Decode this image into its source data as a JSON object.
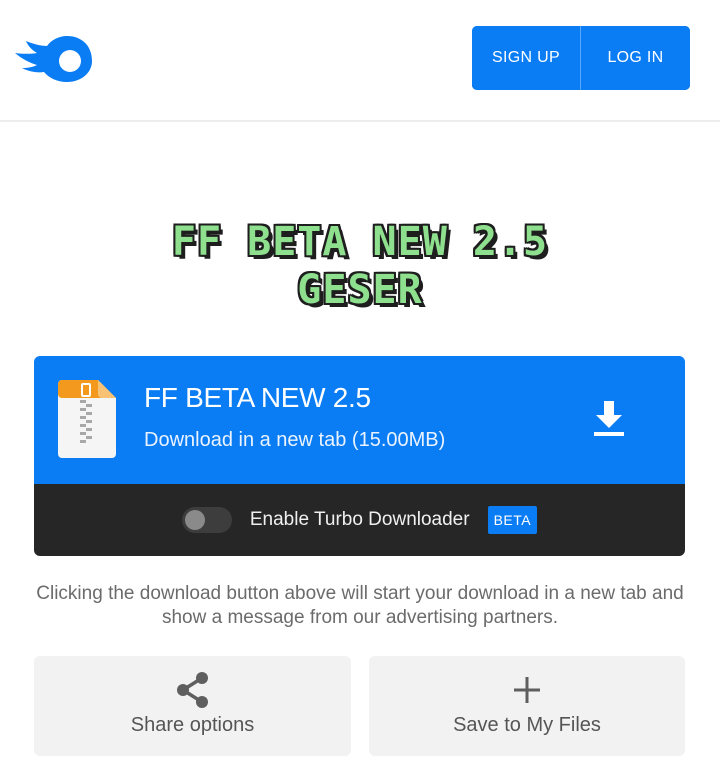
{
  "header": {
    "logo_icon": "flame-logo-icon",
    "signup_label": "SIGN UP",
    "login_label": "LOG IN",
    "accent_color": "#0a7cf4"
  },
  "overlay_title": {
    "line1": "FF BETA NEW 2.5",
    "line2": "GESER"
  },
  "download": {
    "file_icon": "zip-file-icon",
    "file_name": "FF BETA NEW 2.5",
    "subtitle": "Download in a new tab (15.00MB)",
    "action_icon": "download-icon"
  },
  "turbo": {
    "enabled": false,
    "label": "Enable Turbo Downloader",
    "badge": "BETA"
  },
  "notice": "Clicking the download button above will start your download in a new tab and show a message from our advertising partners.",
  "actions": {
    "share": {
      "icon": "share-icon",
      "label": "Share options"
    },
    "save": {
      "icon": "plus-icon",
      "label": "Save to My Files"
    }
  }
}
